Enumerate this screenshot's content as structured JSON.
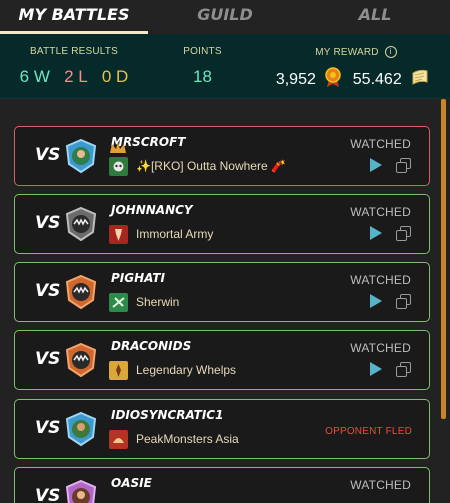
{
  "tabs": [
    {
      "label": "MY BATTLES",
      "active": true
    },
    {
      "label": "GUILD",
      "active": false
    },
    {
      "label": "ALL",
      "active": false
    }
  ],
  "summary": {
    "battle_results_label": "BATTLE RESULTS",
    "wins": "6 W",
    "losses": "2 L",
    "draws": "0 D",
    "points_label": "POINTS",
    "points": "18",
    "reward_label": "MY REWARD",
    "reward_amount_1": "3,952",
    "reward_amount_2": "55.462",
    "info_icon": "i"
  },
  "vs_label": "VS",
  "battles": [
    {
      "opponent": "MRSCROFT",
      "guild": "✨[RKO] Outta Nowhere 🧨",
      "status": "WATCHED",
      "result": "loss",
      "has_actions": true
    },
    {
      "opponent": "JOHNNANCY",
      "guild": "Immortal Army",
      "status": "WATCHED",
      "result": "win",
      "has_actions": true
    },
    {
      "opponent": "PIGHATI",
      "guild": "Sherwin",
      "status": "WATCHED",
      "result": "win",
      "has_actions": true
    },
    {
      "opponent": "DRACONIDS",
      "guild": "Legendary Whelps",
      "status": "WATCHED",
      "result": "win",
      "has_actions": true
    },
    {
      "opponent": "IDIOSYNCRATIC1",
      "guild": "PeakMonsters Asia",
      "status": "OPPONENT FLED",
      "result": "win",
      "has_actions": false
    },
    {
      "opponent": "OASIE",
      "guild": "",
      "status": "WATCHED",
      "result": "win",
      "has_actions": false
    }
  ],
  "colors": {
    "win_border": "#7dbf6e",
    "loss_border": "#d46060",
    "accent_play": "#56b4c8",
    "scrollbar": "#c9852a"
  }
}
